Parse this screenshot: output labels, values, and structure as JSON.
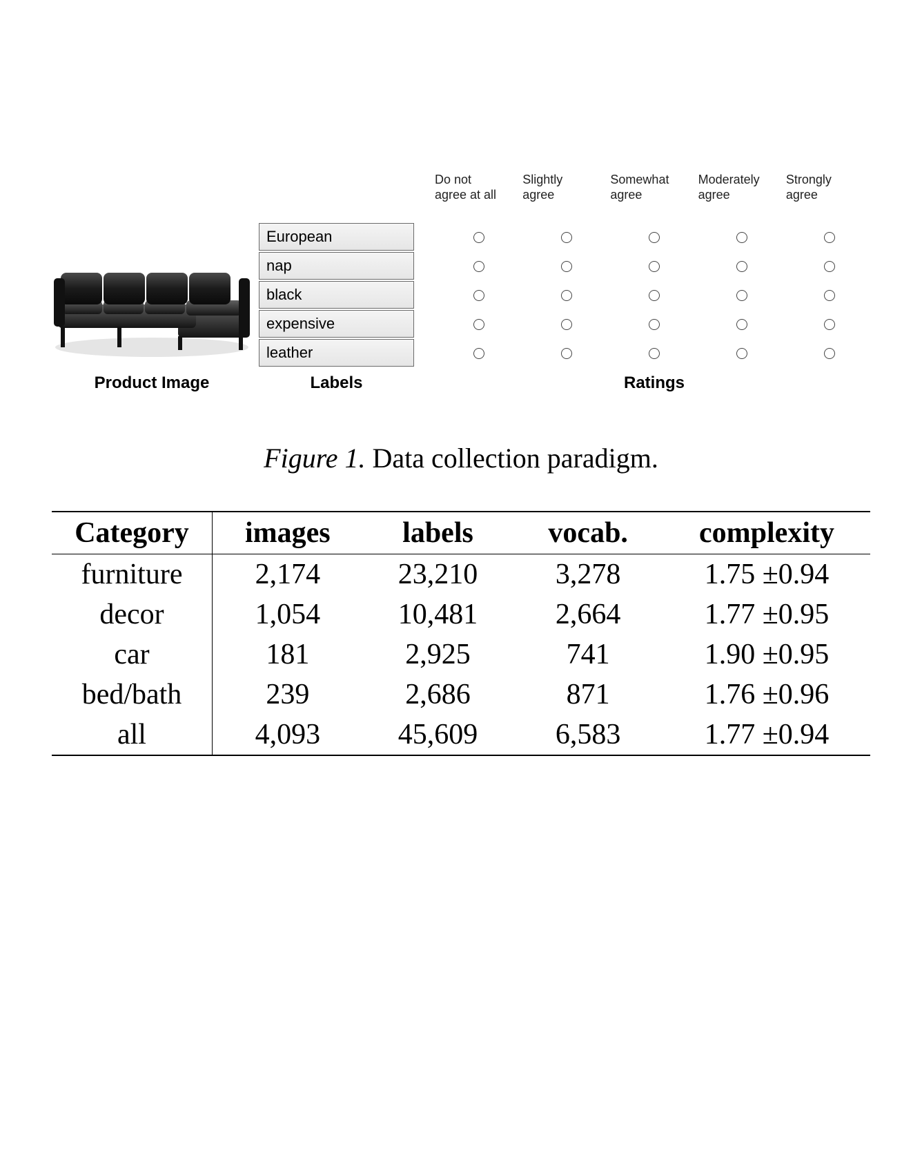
{
  "panel": {
    "rating_headers": [
      "Do not\nagree at all",
      "Slightly\nagree",
      "Somewhat\nagree",
      "Moderately\nagree",
      "Strongly\nagree"
    ],
    "labels": [
      "European",
      "nap",
      "black",
      "expensive",
      "leather"
    ],
    "captions": {
      "image": "Product Image",
      "labels": "Labels",
      "ratings": "Ratings"
    }
  },
  "figure_caption": {
    "number": "Figure 1.",
    "text": " Data collection paradigm."
  },
  "chart_data": {
    "type": "table",
    "title": "",
    "columns": [
      "Category",
      "images",
      "labels",
      "vocab.",
      "complexity"
    ],
    "rows": [
      {
        "category": "furniture",
        "images": "2,174",
        "labels": "23,210",
        "vocab": "3,278",
        "complexity": "1.75 ±0.94"
      },
      {
        "category": "decor",
        "images": "1,054",
        "labels": "10,481",
        "vocab": "2,664",
        "complexity": "1.77 ±0.95"
      },
      {
        "category": "car",
        "images": "181",
        "labels": "2,925",
        "vocab": "741",
        "complexity": "1.90 ±0.95"
      },
      {
        "category": "bed/bath",
        "images": "239",
        "labels": "2,686",
        "vocab": "871",
        "complexity": "1.76 ±0.96"
      },
      {
        "category": "all",
        "images": "4,093",
        "labels": "45,609",
        "vocab": "6,583",
        "complexity": "1.77 ±0.94"
      }
    ]
  }
}
